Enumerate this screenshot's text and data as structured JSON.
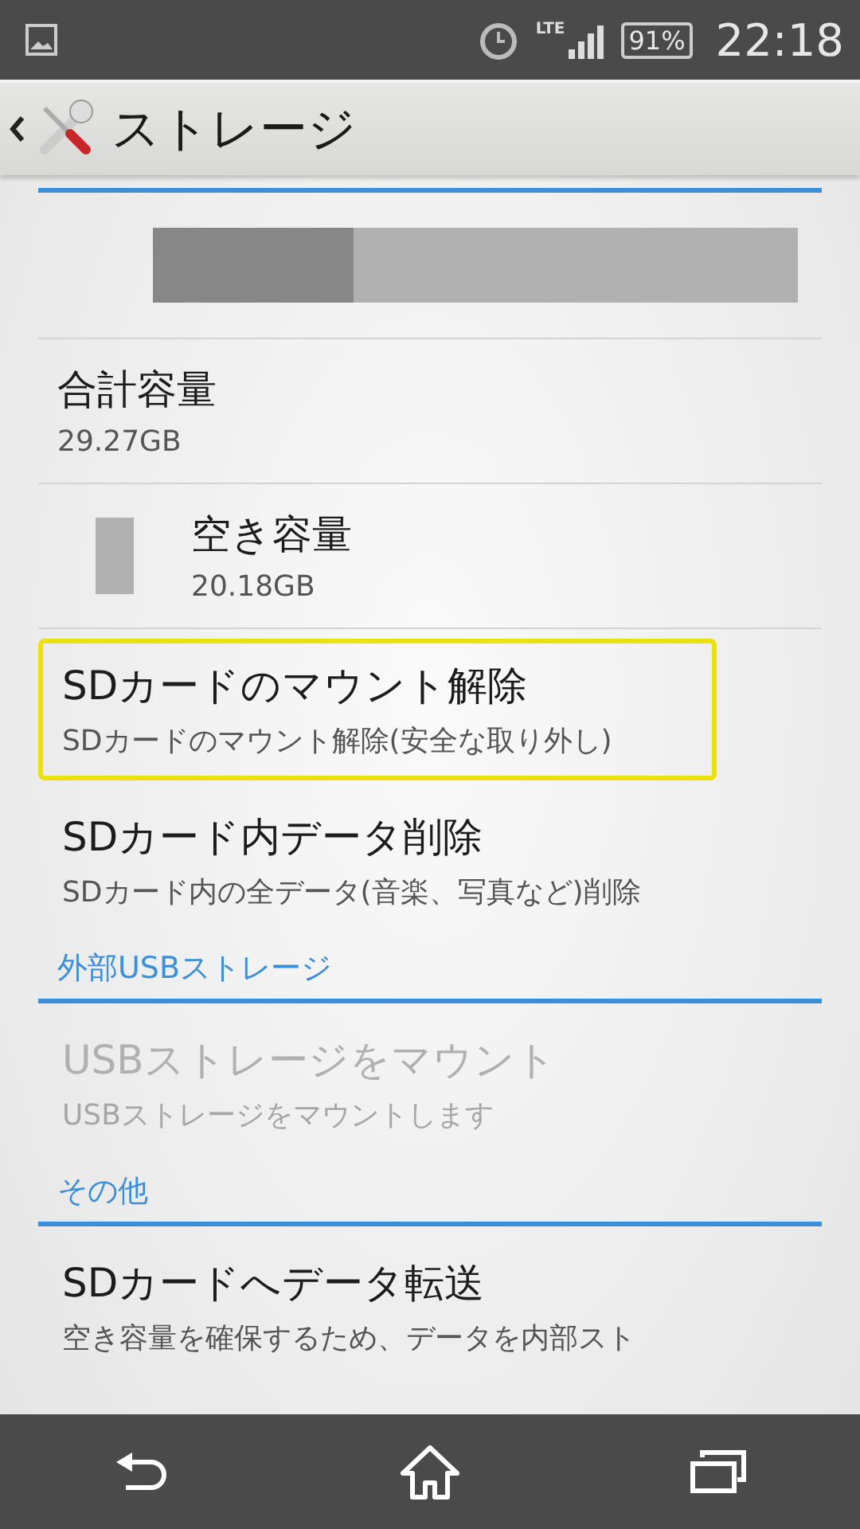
{
  "status_bar": {
    "network": "LTE",
    "battery": "91%",
    "time": "22:18"
  },
  "action_bar": {
    "title": "ストレージ"
  },
  "storage_meter": {
    "level": 0.31
  },
  "stats": [
    {
      "kind": "plain",
      "label": "合計容量",
      "value": "29.27GB"
    },
    {
      "kind": "legend",
      "label": "空き容量",
      "value": "20.18GB"
    }
  ],
  "sections": [
    {
      "items": [
        {
          "title": "SDカードのマウント解除",
          "summary": "SDカードのマウント解除(安全な取り外し)",
          "selected": true,
          "disabled": false
        },
        {
          "title": "SDカード内データ削除",
          "summary": "SDカード内の全データ(音楽、写真など)削除",
          "selected": false,
          "disabled": false
        }
      ]
    },
    {
      "header": "外部USBストレージ",
      "items": [
        {
          "title": "USBストレージをマウント",
          "summary": "USBストレージをマウントします",
          "selected": false,
          "disabled": true
        }
      ]
    },
    {
      "header": "その他",
      "items": [
        {
          "title": "SDカードへデータ転送",
          "summary": "空き容量を確保するため、データを内部スト",
          "selected": false,
          "disabled": false
        }
      ]
    }
  ]
}
